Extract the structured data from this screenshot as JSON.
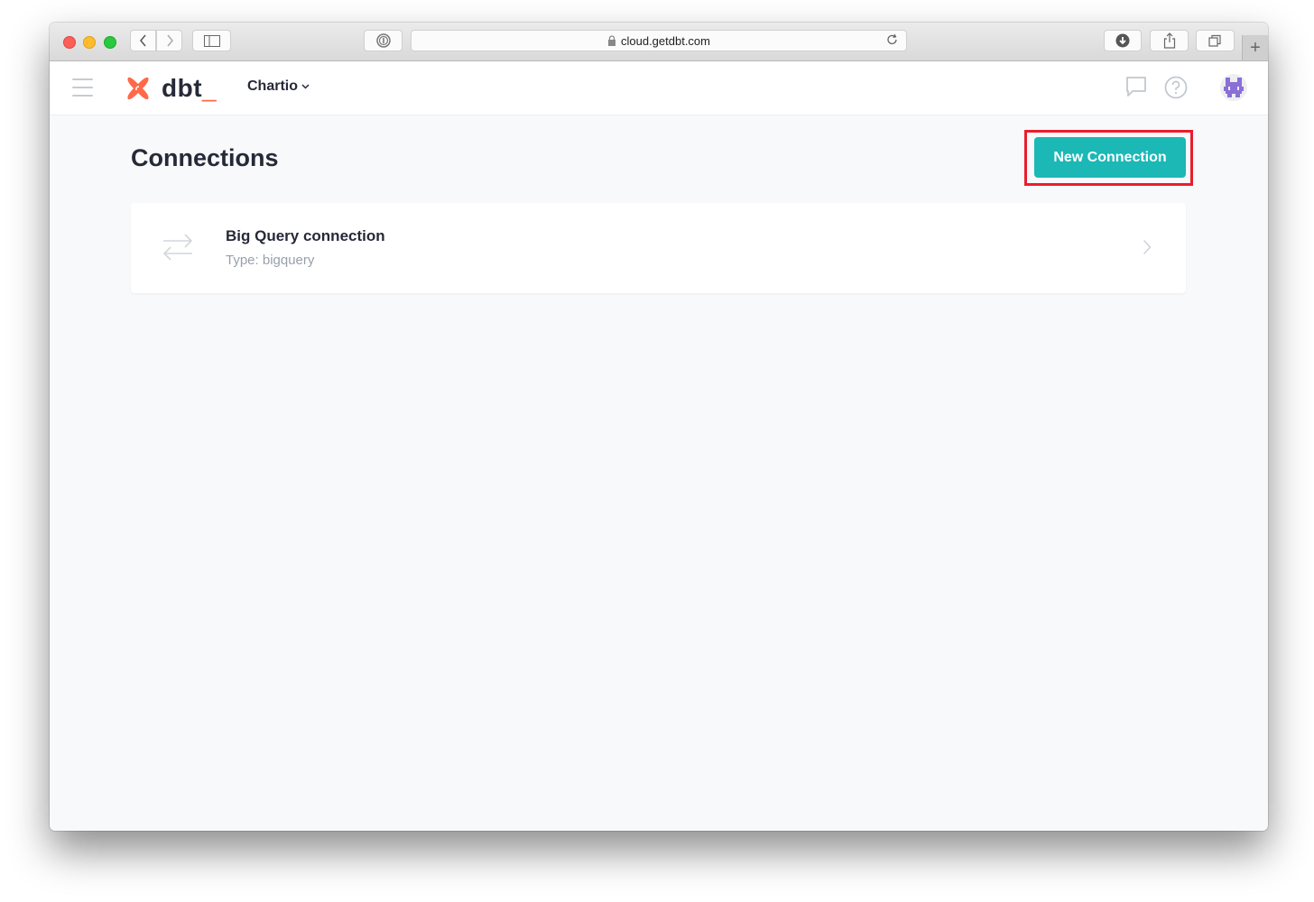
{
  "browser": {
    "url": "cloud.getdbt.com",
    "buttons": [
      "back",
      "forward",
      "sidebar",
      "password-manager",
      "downloads",
      "share",
      "tabs",
      "new-tab"
    ]
  },
  "header": {
    "logo_text": "dbt",
    "logo_underscore": "_",
    "account_name": "Chartio",
    "brand_color": "#ff694a",
    "icons": [
      "menu-icon",
      "chat-icon",
      "help-icon",
      "avatar"
    ]
  },
  "main": {
    "page_title": "Connections",
    "new_connection_label": "New Connection",
    "accent_color": "#1bb8b6",
    "connections": [
      {
        "name": "Big Query connection",
        "type_label": "Type: bigquery"
      }
    ]
  }
}
